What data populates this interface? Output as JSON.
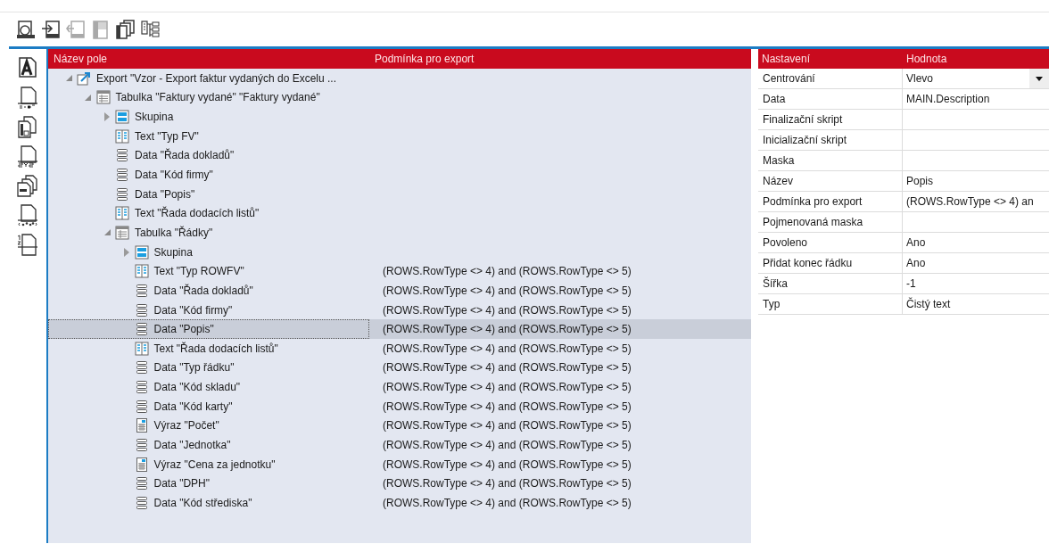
{
  "toolbar": [
    {
      "disabled": false
    },
    {
      "disabled": false
    },
    {
      "disabled": true
    },
    {
      "disabled": true
    },
    {
      "disabled": false
    },
    {
      "disabled": false
    }
  ],
  "tree": {
    "columns": [
      "Název pole",
      "Podmínka pro export"
    ],
    "nodes": [
      {
        "kind": "export",
        "label": "Export \"Vzor - Export faktur vydaných do Excelu ...",
        "expanded": true,
        "selected": false,
        "children": [
          {
            "kind": "table",
            "label": "Tabulka \"Faktury vydané\" \"Faktury vydané\"",
            "expanded": true,
            "selected": false,
            "children": [
              {
                "kind": "group",
                "label": "Skupina",
                "expanded": false,
                "selected": false
              },
              {
                "kind": "text",
                "label": "Text \"Typ FV\"",
                "selected": false
              },
              {
                "kind": "data",
                "label": "Data \"Řada dokladů\"",
                "selected": false
              },
              {
                "kind": "data",
                "label": "Data \"Kód firmy\"",
                "selected": false
              },
              {
                "kind": "data",
                "label": "Data \"Popis\"",
                "selected": false
              },
              {
                "kind": "text",
                "label": "Text \"Řada dodacích listů\"",
                "selected": false
              },
              {
                "kind": "table",
                "label": "Tabulka \"Řádky\"",
                "expanded": true,
                "selected": false,
                "children": [
                  {
                    "kind": "group",
                    "label": "Skupina",
                    "expanded": false,
                    "selected": false
                  },
                  {
                    "kind": "text",
                    "label": "Text \"Typ ROWFV\"",
                    "condition": "(ROWS.RowType <> 4) and (ROWS.RowType <> 5)",
                    "selected": false
                  },
                  {
                    "kind": "data",
                    "label": "Data \"Řada dokladů\"",
                    "condition": "(ROWS.RowType <> 4) and (ROWS.RowType <> 5)",
                    "selected": false
                  },
                  {
                    "kind": "data",
                    "label": "Data \"Kód firmy\"",
                    "condition": "(ROWS.RowType <> 4) and (ROWS.RowType <> 5)",
                    "selected": false
                  },
                  {
                    "kind": "data",
                    "label": "Data \"Popis\"",
                    "condition": "(ROWS.RowType <> 4) and (ROWS.RowType <> 5)",
                    "selected": true
                  },
                  {
                    "kind": "text",
                    "label": "Text \"Řada dodacích listů\"",
                    "condition": "(ROWS.RowType <> 4) and (ROWS.RowType <> 5)",
                    "selected": false
                  },
                  {
                    "kind": "data",
                    "label": "Data \"Typ řádku\"",
                    "condition": "(ROWS.RowType <> 4) and (ROWS.RowType <> 5)",
                    "selected": false
                  },
                  {
                    "kind": "data",
                    "label": "Data \"Kód skladu\"",
                    "condition": "(ROWS.RowType <> 4) and (ROWS.RowType <> 5)",
                    "selected": false
                  },
                  {
                    "kind": "data",
                    "label": "Data \"Kód karty\"",
                    "condition": "(ROWS.RowType <> 4) and (ROWS.RowType <> 5)",
                    "selected": false
                  },
                  {
                    "kind": "expression",
                    "label": "Výraz \"Počet\"",
                    "condition": "(ROWS.RowType <> 4) and (ROWS.RowType <> 5)",
                    "selected": false
                  },
                  {
                    "kind": "data",
                    "label": "Data \"Jednotka\"",
                    "condition": "(ROWS.RowType <> 4) and (ROWS.RowType <> 5)",
                    "selected": false
                  },
                  {
                    "kind": "expression",
                    "label": "Výraz \"Cena za jednotku\"",
                    "condition": "(ROWS.RowType <> 4) and (ROWS.RowType <> 5)",
                    "selected": false
                  },
                  {
                    "kind": "data",
                    "label": "Data \"DPH\"",
                    "condition": "(ROWS.RowType <> 4) and (ROWS.RowType <> 5)",
                    "selected": false
                  },
                  {
                    "kind": "data",
                    "label": "Data \"Kód střediska\"",
                    "condition": "(ROWS.RowType <> 4) and (ROWS.RowType <> 5)",
                    "selected": false
                  }
                ]
              }
            ]
          }
        ]
      }
    ]
  },
  "properties": {
    "columns": [
      "Nastavení",
      "Hodnota"
    ],
    "rows": [
      {
        "name": "Centrování",
        "value": "Vlevo",
        "kind": "dropdown"
      },
      {
        "name": "Data",
        "value": "MAIN.Description",
        "kind": "text"
      },
      {
        "name": "Finalizační skript",
        "kind": "text"
      },
      {
        "name": "Inicializační skript",
        "kind": "text"
      },
      {
        "name": "Maska",
        "kind": "text"
      },
      {
        "name": "Název",
        "value": "Popis",
        "kind": "text"
      },
      {
        "name": "Podmínka pro export",
        "value": "(ROWS.RowType <> 4) an",
        "kind": "text"
      },
      {
        "name": "Pojmenovaná maska",
        "kind": "text"
      },
      {
        "name": "Povoleno",
        "value": "Ano",
        "kind": "text"
      },
      {
        "name": "Přidat konec řádku",
        "value": "Ano",
        "kind": "text"
      },
      {
        "name": "Šířka",
        "value": "-1",
        "kind": "text"
      },
      {
        "name": "Typ",
        "value": "Čistý text",
        "kind": "text"
      }
    ]
  }
}
